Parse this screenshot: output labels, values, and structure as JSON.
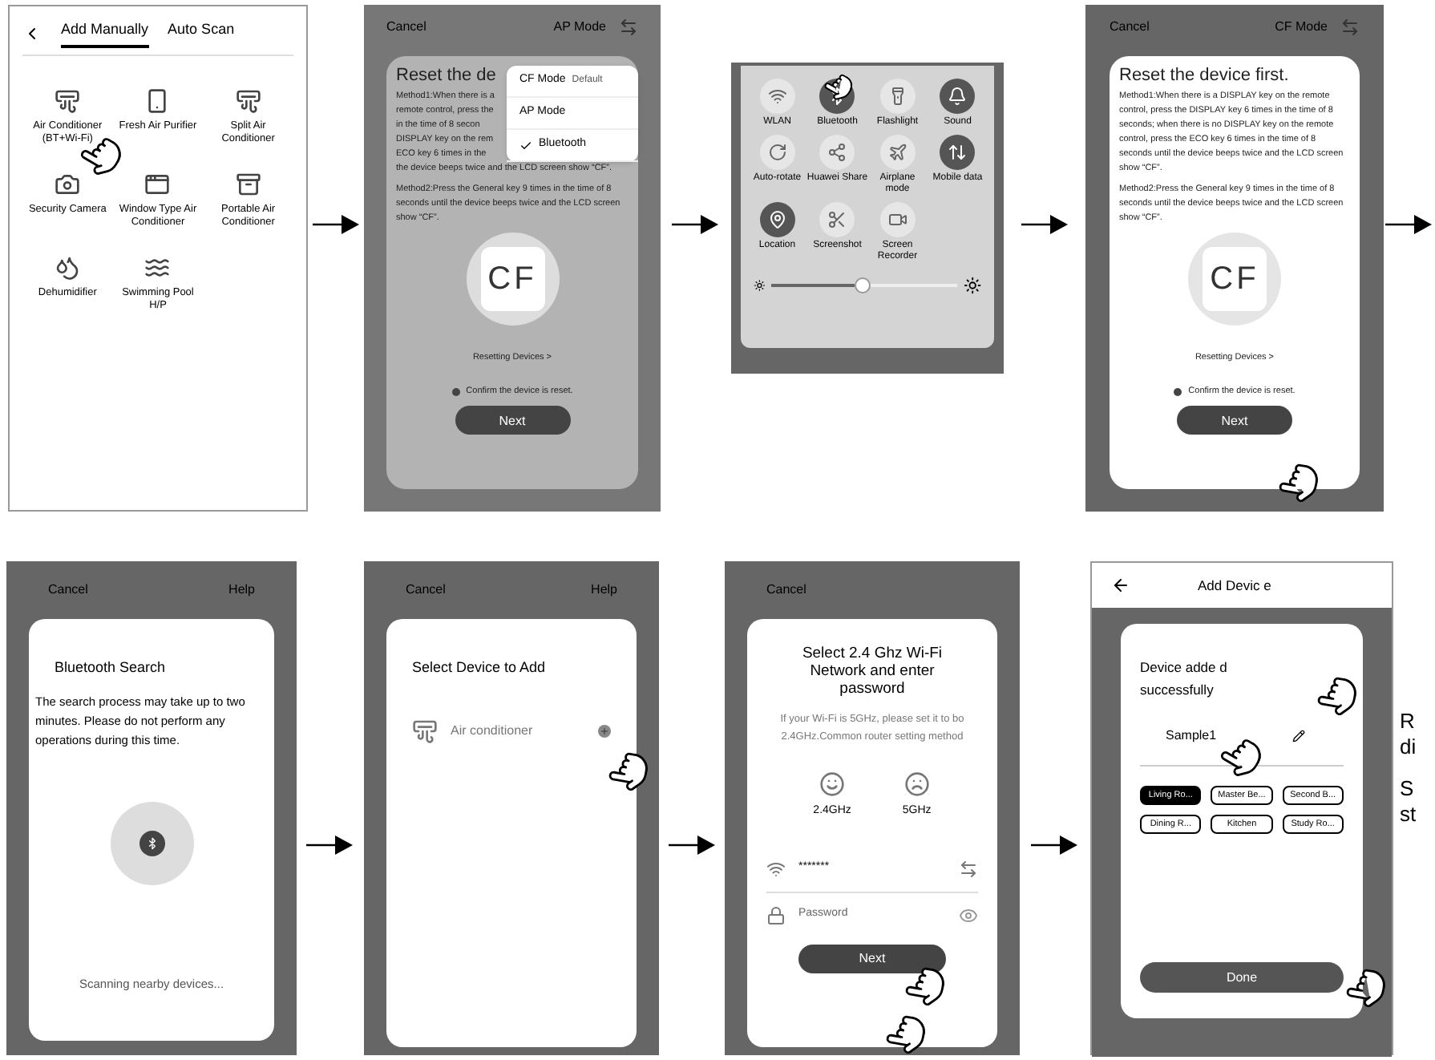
{
  "step1": {
    "tabs": [
      {
        "label": "Add Manually",
        "selected": true
      },
      {
        "label": "Auto Scan",
        "selected": false
      }
    ],
    "devices": [
      "Air Conditioner (BT+Wi-Fi)",
      "Fresh Air Purifier",
      "Split Air Conditioner",
      "Security Camera",
      "Window Type Air Conditioner",
      "Portable Air Conditioner",
      "Dehumidifier",
      "Swimming Pool H/P"
    ]
  },
  "step2": {
    "cancel": "Cancel",
    "mode": "AP Mode",
    "title": "Reset the de",
    "menu": [
      {
        "label": "CF Mode",
        "tag": "Default",
        "checked": false
      },
      {
        "label": "AP Mode",
        "checked": false
      },
      {
        "label": "Bluetooth",
        "checked": true
      }
    ],
    "method1_lines": [
      "Method1:When there is a",
      "remote control, press the",
      "in the time of 8 secon",
      "DISPLAY key on the rem",
      "ECO key 6 times in the"
    ],
    "method1_tail": "the device beeps twice and the LCD screen show “CF”.",
    "method2": "Method2:Press the General key 9 times in the time of 8 seconds until the device beeps twice and the LCD screen show “CF”.",
    "lcd": "CF",
    "link": "Resetting Devices >",
    "confirm": "Confirm the device is reset.",
    "next": "Next"
  },
  "step3": {
    "tiles": [
      {
        "label": "WLAN",
        "on": false
      },
      {
        "label": "Bluetooth",
        "on": true
      },
      {
        "label": "Flashlight",
        "on": false
      },
      {
        "label": "Sound",
        "on": true
      },
      {
        "label": "Auto-rotate",
        "on": false
      },
      {
        "label": "Huawei Share",
        "on": false
      },
      {
        "label": "Airplane mode",
        "on": false
      },
      {
        "label": "Mobile data",
        "on": true
      },
      {
        "label": "Location",
        "on": true
      },
      {
        "label": "Screenshot",
        "on": false
      },
      {
        "label": "Screen Recorder",
        "on": false
      }
    ],
    "brightness": {
      "level": 0.45
    }
  },
  "step4": {
    "cancel": "Cancel",
    "mode": "CF Mode",
    "title": "Reset the device first.",
    "method1": "Method1:When there is a DISPLAY key on the remote control, press the DISPLAY key 6 times in the time of 8 seconds; when there is no DISPLAY key on the remote control, press the ECO key 6 times in the time of 8 seconds until the device beeps twice and the LCD screen show “CF”.",
    "method2": "Method2:Press the General key 9 times in the time of 8 seconds until the device beeps twice and the LCD screen show “CF”.",
    "lcd": "CF",
    "link": "Resetting Devices >",
    "confirm": "Confirm the device is reset.",
    "next": "Next"
  },
  "step5": {
    "cancel": "Cancel",
    "help": "Help",
    "title": "Bluetooth Search",
    "text": "The search process may take up to two minutes. Please do not perform any operations during this time.",
    "status": "Scanning nearby devices..."
  },
  "step6": {
    "cancel": "Cancel",
    "help": "Help",
    "title": "Select Device to Add",
    "device": "Air conditioner"
  },
  "step7": {
    "cancel": "Cancel",
    "title": "Select 2.4 Ghz Wi-Fi Network and enter password",
    "hint": "If your Wi-Fi is 5GHz, please set it to bo 2.4GHz.Common router setting method",
    "bands": [
      "2.4GHz",
      "5GHz"
    ],
    "wifi": {
      "value": "*******"
    },
    "password": {
      "placeholder": "Password"
    },
    "next": "Next"
  },
  "step8": {
    "title": "Add Devic e",
    "message": "Device adde d successfully",
    "name": "Sample1",
    "rooms": [
      {
        "label": "Living Ro...",
        "selected": true
      },
      {
        "label": "Master Be...",
        "selected": false
      },
      {
        "label": "Second B...",
        "selected": false
      },
      {
        "label": "Dining R...",
        "selected": false
      },
      {
        "label": "Kitchen",
        "selected": false
      },
      {
        "label": "Study Ro...",
        "selected": false
      }
    ],
    "done": "Done"
  },
  "annotations": [
    [
      "R",
      "di"
    ],
    [
      "S",
      "st"
    ]
  ]
}
